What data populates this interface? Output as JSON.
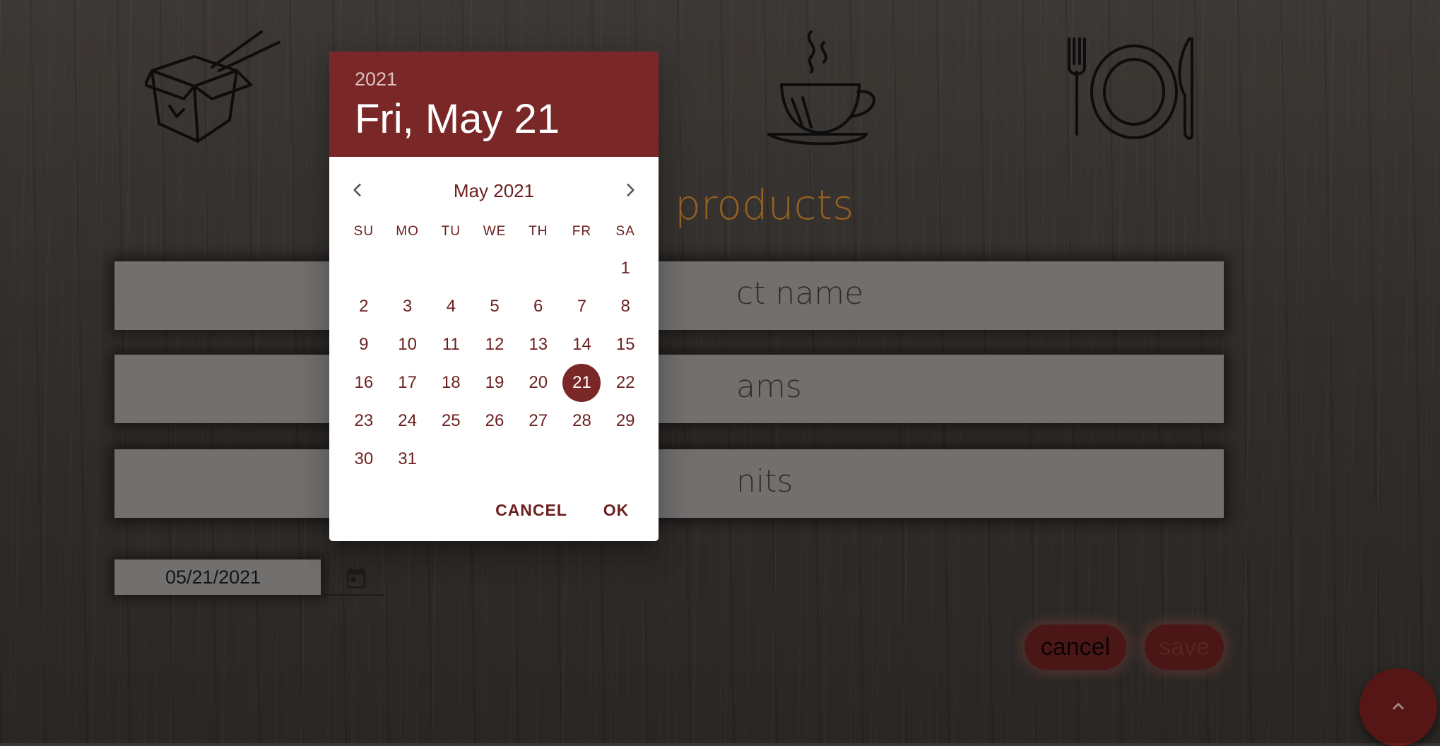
{
  "page": {
    "title": "products",
    "fields": [
      {
        "placeholder": "ct name"
      },
      {
        "placeholder": "ams"
      },
      {
        "placeholder": "nits"
      }
    ],
    "date_value": "05/21/2021",
    "cancel_label": "cancel",
    "save_label": "save",
    "icons": [
      "takeout-box-icon",
      "coffee-cup-icon",
      "plate-cutlery-icon",
      "calendar-icon",
      "chevron-up-icon"
    ]
  },
  "picker": {
    "year": "2021",
    "selected_date": "Fri, May 21",
    "month_label": "May 2021",
    "weekdays": [
      "SU",
      "MO",
      "TU",
      "WE",
      "TH",
      "FR",
      "SA"
    ],
    "weeks": [
      [
        "",
        "",
        "",
        "",
        "",
        "",
        "1"
      ],
      [
        "2",
        "3",
        "4",
        "5",
        "6",
        "7",
        "8"
      ],
      [
        "9",
        "10",
        "11",
        "12",
        "13",
        "14",
        "15"
      ],
      [
        "16",
        "17",
        "18",
        "19",
        "20",
        "21",
        "22"
      ],
      [
        "23",
        "24",
        "25",
        "26",
        "27",
        "28",
        "29"
      ],
      [
        "30",
        "31",
        "",
        "",
        "",
        "",
        ""
      ]
    ],
    "selected_day": "21",
    "cancel_label": "CANCEL",
    "ok_label": "OK"
  },
  "colors": {
    "primary": "#7a2727",
    "text_primary": "#6b1f1f",
    "title_accent": "#b8772a"
  }
}
